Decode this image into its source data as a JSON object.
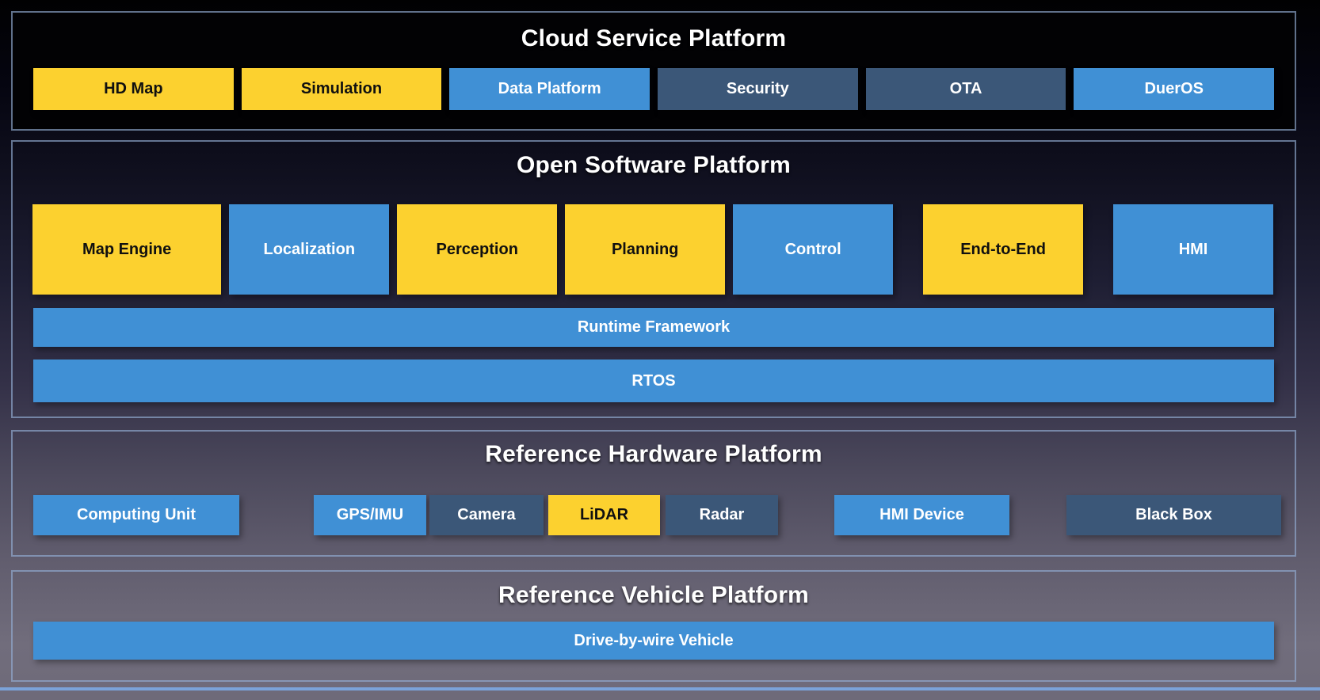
{
  "colors": {
    "yellow_block": "#fcd12f",
    "blue_block": "#4090d5",
    "slate_block": "#3b5778",
    "section_border": "#94add4",
    "bottom_divider": "#7ba3d9",
    "title_text": "#ffffff"
  },
  "sections": {
    "cloud": {
      "title": "Cloud Service Platform",
      "items": [
        {
          "label": "HD Map",
          "variant": "yellow"
        },
        {
          "label": "Simulation",
          "variant": "yellow"
        },
        {
          "label": "Data Platform",
          "variant": "blue"
        },
        {
          "label": "Security",
          "variant": "slate"
        },
        {
          "label": "OTA",
          "variant": "slate"
        },
        {
          "label": "DuerOS",
          "variant": "blue"
        }
      ]
    },
    "software": {
      "title": "Open Software Platform",
      "modules": [
        {
          "label": "Map Engine",
          "variant": "yellow"
        },
        {
          "label": "Localization",
          "variant": "blue"
        },
        {
          "label": "Perception",
          "variant": "yellow"
        },
        {
          "label": "Planning",
          "variant": "yellow"
        },
        {
          "label": "Control",
          "variant": "blue"
        },
        {
          "label": "End-to-End",
          "variant": "yellow"
        },
        {
          "label": "HMI",
          "variant": "blue"
        }
      ],
      "runtime_bar": {
        "label": "Runtime Framework",
        "variant": "blue"
      },
      "rtos_bar": {
        "label": "RTOS",
        "variant": "blue"
      }
    },
    "hardware": {
      "title": "Reference Hardware Platform",
      "items": [
        {
          "label": "Computing Unit",
          "variant": "blue"
        },
        {
          "label": "GPS/IMU",
          "variant": "blue"
        },
        {
          "label": "Camera",
          "variant": "slate"
        },
        {
          "label": "LiDAR",
          "variant": "yellow"
        },
        {
          "label": "Radar",
          "variant": "slate"
        },
        {
          "label": "HMI Device",
          "variant": "blue"
        },
        {
          "label": "Black Box",
          "variant": "slate"
        }
      ]
    },
    "vehicle": {
      "title": "Reference Vehicle Platform",
      "bar": {
        "label": "Drive-by-wire Vehicle",
        "variant": "blue"
      }
    }
  }
}
